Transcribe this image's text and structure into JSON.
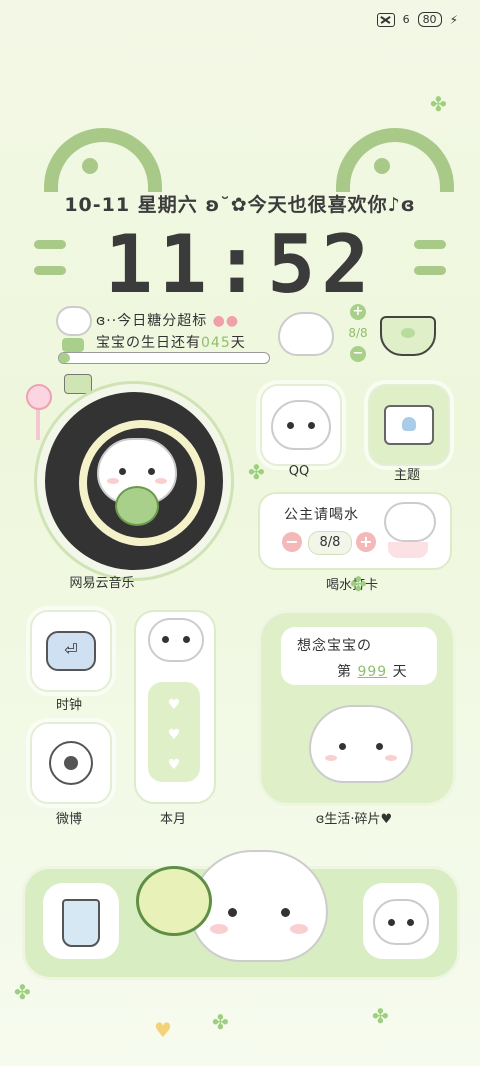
{
  "status_bar": {
    "sim_icon": "sim-none-icon",
    "signal_text": "6",
    "battery_level": "80",
    "charging_icon": "lightning-icon"
  },
  "header": {
    "date_line": "10-11 星期六 ʚ˘✿今天也很喜欢你♪ɞ",
    "clock_time": "11:52"
  },
  "status_widget": {
    "sugar_line": "ɞ··今日糖分超标",
    "birthday_prefix": "宝宝の生日还有",
    "birthday_days": "045",
    "birthday_suffix": "天",
    "progress_fraction": 0.05
  },
  "mini_water": {
    "count": "8/8",
    "plus": "+",
    "minus": "−"
  },
  "apps": {
    "music": {
      "label": "网易云音乐",
      "icon": "music-cat-icon"
    },
    "qq": {
      "label": "QQ",
      "icon": "qq-cat-icon"
    },
    "theme": {
      "label": "主题",
      "icon": "tshirt-icon"
    },
    "water": {
      "label": "喝水打卡",
      "title": "公主请喝水",
      "count": "8/8",
      "minus": "−",
      "plus": "+"
    },
    "clock": {
      "label": "时钟",
      "icon": "alarm-clock-icon"
    },
    "weibo": {
      "label": "微博",
      "icon": "weibo-icon"
    },
    "month": {
      "label": "本月"
    },
    "photo": {
      "label": "ɞ生活·碎片♥",
      "miss_line": "想念宝宝の",
      "day_prefix": "第",
      "day_value": "999",
      "day_suffix": "天"
    }
  },
  "dock": {
    "left_icon": "drink-cup-icon",
    "right_icon": "cat-sticker-icon"
  },
  "colors": {
    "accent_green": "#a9c989",
    "background": "#f3f8e6",
    "pink": "#f0a0a8",
    "dark": "#333333"
  }
}
